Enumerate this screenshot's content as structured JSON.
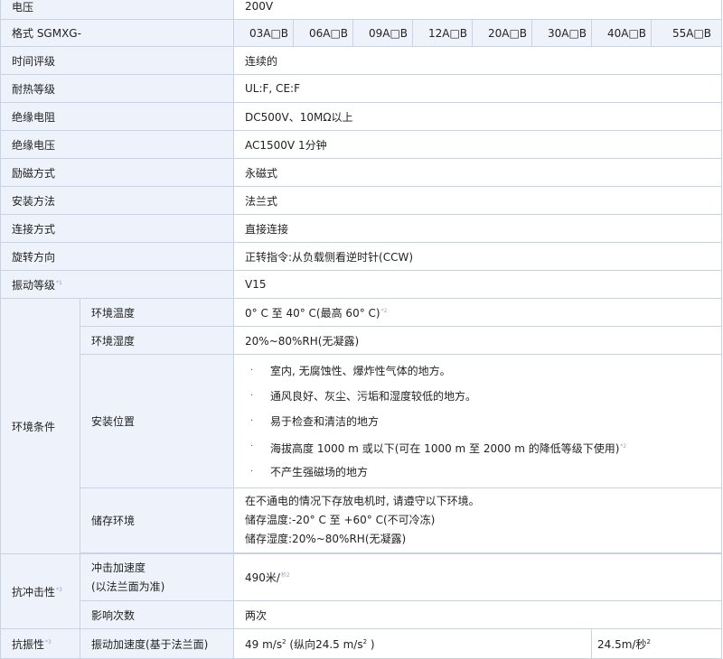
{
  "voltage": {
    "label": "电压",
    "value": "200V"
  },
  "model": {
    "label": "格式 SGMXG-",
    "variants": [
      "03A□B",
      "06A□B",
      "09A□B",
      "12A□B",
      "20A□B",
      "30A□B",
      "40A□B",
      "55A□B"
    ]
  },
  "rows": [
    {
      "label": "时间评级",
      "value": "连续的"
    },
    {
      "label": "耐热等级",
      "value": "UL:F, CE:F"
    },
    {
      "label": "绝缘电阻",
      "value": "DC500V、10MΩ以上"
    },
    {
      "label": "绝缘电压",
      "value": "AC1500V 1分钟"
    },
    {
      "label": "励磁方式",
      "value": "永磁式"
    },
    {
      "label": "安装方法",
      "value": "法兰式"
    },
    {
      "label": "连接方式",
      "value": "直接连接"
    },
    {
      "label": "旋转方向",
      "value": "正转指令:从负载侧看逆时针(CCW)"
    }
  ],
  "vibration_class": {
    "label": "振动等级",
    "note": "*1",
    "value": "V15"
  },
  "environment": {
    "label": "环境条件",
    "temperature": {
      "label": "环境温度",
      "value": "0° C 至 40° C(最高 60° C)",
      "note": "*2"
    },
    "humidity": {
      "label": "环境湿度",
      "value": "20%~80%RH(无凝露)"
    },
    "installation": {
      "label": "安装位置",
      "items": [
        {
          "text": "室内, 无腐蚀性、爆炸性气体的地方。",
          "note": ""
        },
        {
          "text": "通风良好、灰尘、污垢和湿度较低的地方。",
          "note": ""
        },
        {
          "text": "易于检查和清洁的地方",
          "note": ""
        },
        {
          "text": "海拔高度 1000 m 或以下(可在 1000 m 至 2000 m 的降低等级下使用)",
          "note": "*2"
        },
        {
          "text": "不产生强磁场的地方",
          "note": ""
        }
      ]
    },
    "storage": {
      "label": "储存环境",
      "lines": [
        "在不通电的情况下存放电机时, 请遵守以下环境。",
        "储存温度:-20° C 至 +60° C(不可冷冻)",
        "储存湿度:20%~80%RH(无凝露)"
      ]
    }
  },
  "shock": {
    "label": "抗冲击性",
    "note": "*3",
    "acceleration": {
      "label1": "冲击加速度",
      "label2": "(以法兰面为准)",
      "value": "490米/",
      "unit_sup": "秒2"
    },
    "count": {
      "label": "影响次数",
      "value": "两次"
    }
  },
  "vibration": {
    "label": "抗振性",
    "note": "*3",
    "acceleration": {
      "label": "振动加速度(基于法兰面)",
      "value_a": "49 m/s",
      "sup_a": "2",
      "value_b": "(纵向24.5 m/s",
      "sup_b": "2",
      "value_c": ")",
      "value2": "24.5m/秒",
      "sup2": "2"
    }
  }
}
